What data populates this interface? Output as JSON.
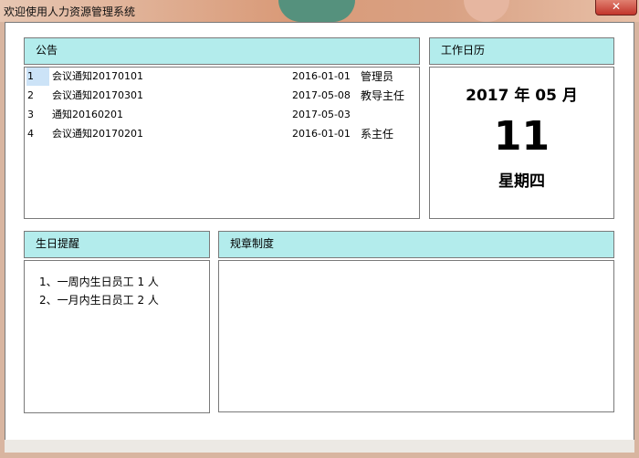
{
  "window": {
    "title": "欢迎使用人力资源管理系统",
    "close_symbol": "✕"
  },
  "notice": {
    "header": "公告",
    "rows": [
      {
        "num": "1",
        "title": "会议通知20170101",
        "date": "2016-01-01",
        "publisher": "管理员"
      },
      {
        "num": "2",
        "title": "会议通知20170301",
        "date": "2017-05-08",
        "publisher": "教导主任"
      },
      {
        "num": "3",
        "title": "通知20160201",
        "date": "2017-05-03",
        "publisher": ""
      },
      {
        "num": "4",
        "title": "会议通知20170201",
        "date": "2016-01-01",
        "publisher": "系主任"
      }
    ]
  },
  "calendar": {
    "header": "工作日历",
    "year_month": "2017 年 05 月",
    "day": "11",
    "weekday": "星期四"
  },
  "birthday": {
    "header": "生日提醒",
    "lines": [
      "1、一周内生日员工 1 人",
      "2、一月内生日员工 2 人"
    ]
  },
  "rules": {
    "header": "规章制度"
  }
}
